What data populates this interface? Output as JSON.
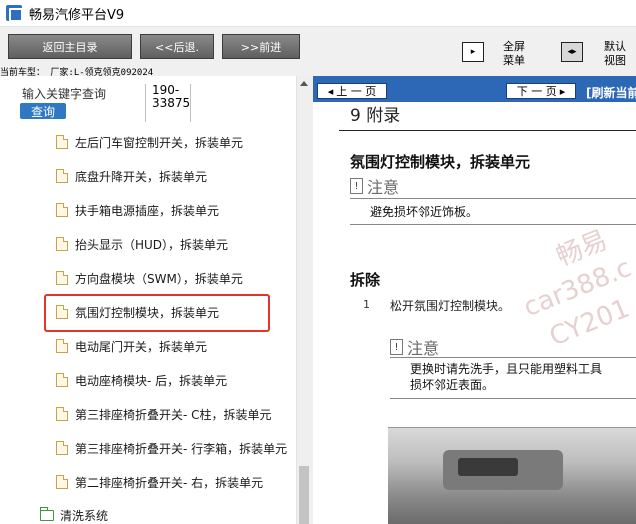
{
  "window": {
    "title": "畅易汽修平台V9"
  },
  "toolbar": {
    "home_label": "返回主目录",
    "back_label": "<<后退.",
    "forward_label": ">>前进",
    "fullscreen_label_1": "全屏",
    "fullscreen_label_2": "菜单",
    "default_label_1": "默认",
    "default_label_2": "视图"
  },
  "model_line": "当前车型： 厂家:L-领克领克092024",
  "search": {
    "label": "输入关键字查询",
    "button": "查询",
    "range_start": "190-",
    "range_end": "33875"
  },
  "tree_items": [
    {
      "label": "左后门车窗控制开关，拆装单元"
    },
    {
      "label": "底盘升降开关，拆装单元"
    },
    {
      "label": "扶手箱电源插座，拆装单元"
    },
    {
      "label": "抬头显示（HUD），拆装单元"
    },
    {
      "label": "方向盘模块（SWM），拆装单元"
    },
    {
      "label": "氛围灯控制模块，拆装单元"
    },
    {
      "label": "电动尾门开关，拆装单元"
    },
    {
      "label": "电动座椅模块- 后，拆装单元"
    },
    {
      "label": "第三排座椅折叠开关- C柱，拆装单元"
    },
    {
      "label": "第三排座椅折叠开关- 行李箱，拆装单元"
    },
    {
      "label": "第二排座椅折叠开关- 右，拆装单元"
    }
  ],
  "tree_folder": {
    "label": "清洗系统"
  },
  "nav": {
    "prev_label": "上 一 页",
    "next_label": "下 一 页",
    "refresh_label": "[刷新当前"
  },
  "doc": {
    "chapter": "9 附录",
    "heading": "氛围灯控制模块，拆装单元",
    "caution_word": "注意",
    "caution1_text": "避免损坏邻近饰板。",
    "section": "拆除",
    "step_num": "1",
    "step_text": "松开氛围灯控制模块。",
    "caution2_line1": "更换时请先洗手，且只能用塑料工具",
    "caution2_line2": "损坏邻近表面。",
    "watermark_1": "畅易",
    "watermark_2": "car388.c",
    "watermark_3": "CY201"
  },
  "colors": {
    "accent_blue": "#2c68b6",
    "highlight_red": "#e0352b",
    "toolbar_button": "#6f6f6f"
  }
}
